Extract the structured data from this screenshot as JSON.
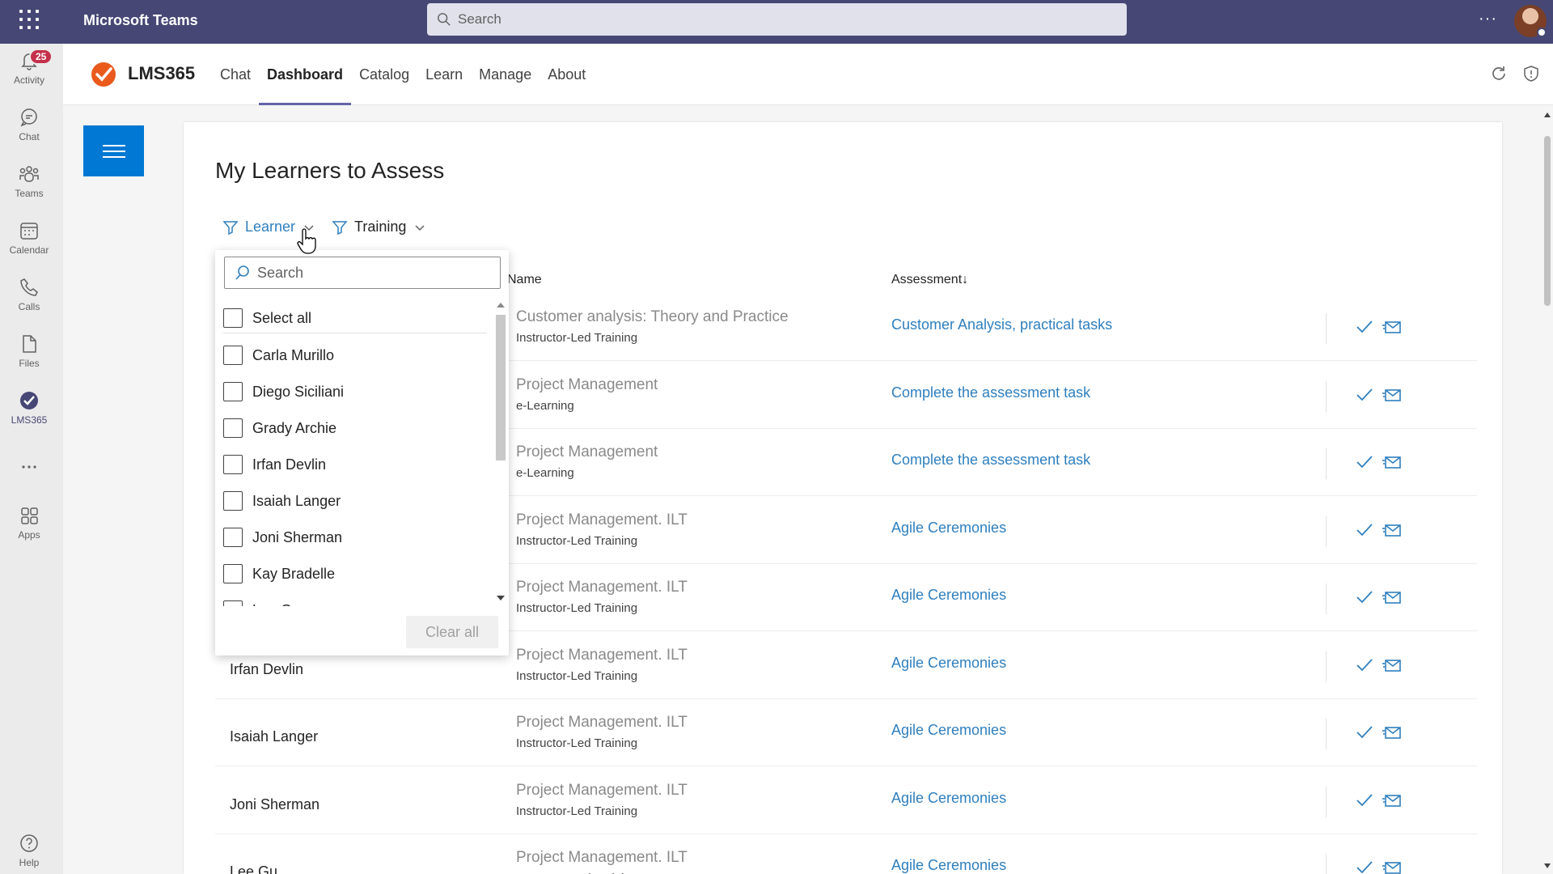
{
  "titlebar": {
    "app_name": "Microsoft Teams",
    "search_placeholder": "Search",
    "more": "···"
  },
  "rail": {
    "items": [
      {
        "label": "Activity",
        "icon": "bell-icon",
        "badge": "25"
      },
      {
        "label": "Chat",
        "icon": "chat-icon"
      },
      {
        "label": "Teams",
        "icon": "teams-icon"
      },
      {
        "label": "Calendar",
        "icon": "calendar-icon"
      },
      {
        "label": "Calls",
        "icon": "phone-icon"
      },
      {
        "label": "Files",
        "icon": "file-icon"
      },
      {
        "label": "LMS365",
        "icon": "lms365-icon"
      },
      {
        "label": "",
        "icon": "more-icon"
      },
      {
        "label": "Apps",
        "icon": "apps-icon"
      },
      {
        "label": "Help",
        "icon": "help-icon"
      }
    ]
  },
  "appbar": {
    "title": "LMS365",
    "tabs": [
      {
        "label": "Chat",
        "active": false
      },
      {
        "label": "Dashboard",
        "active": true
      },
      {
        "label": "Catalog",
        "active": false
      },
      {
        "label": "Learn",
        "active": false
      },
      {
        "label": "Manage",
        "active": false
      },
      {
        "label": "About",
        "active": false
      }
    ]
  },
  "main": {
    "title": "My Learners to Assess",
    "filters": {
      "learner": "Learner",
      "training": "Training"
    },
    "columns": {
      "training_name": "Name",
      "assessment": "Assessment",
      "sort_indicator": "↓"
    },
    "rows": [
      {
        "learner": "",
        "training": "Customer analysis: Theory and Practice",
        "type": "Instructor-Led Training",
        "assessment": "Customer Analysis, practical tasks"
      },
      {
        "learner": "",
        "training": "Project Management",
        "type": "e-Learning",
        "assessment": "Complete the assessment task"
      },
      {
        "learner": "",
        "training": "Project Management",
        "type": "e-Learning",
        "assessment": "Complete the assessment task"
      },
      {
        "learner": "",
        "training": "Project Management. ILT",
        "type": "Instructor-Led Training",
        "assessment": "Agile Ceremonies"
      },
      {
        "learner": "",
        "training": "Project Management. ILT",
        "type": "Instructor-Led Training",
        "assessment": "Agile Ceremonies"
      },
      {
        "learner": "Irfan Devlin",
        "training": "Project Management. ILT",
        "type": "Instructor-Led Training",
        "assessment": "Agile Ceremonies"
      },
      {
        "learner": "Isaiah Langer",
        "training": "Project Management. ILT",
        "type": "Instructor-Led Training",
        "assessment": "Agile Ceremonies"
      },
      {
        "learner": "Joni Sherman",
        "training": "Project Management. ILT",
        "type": "Instructor-Led Training",
        "assessment": "Agile Ceremonies"
      },
      {
        "learner": "Lee Gu",
        "training": "Project Management. ILT",
        "type": "Instructor-Led Training",
        "assessment": "Agile Ceremonies"
      }
    ]
  },
  "dropdown": {
    "search_placeholder": "Search",
    "select_all": "Select all",
    "options": [
      "Carla Murillo",
      "Diego Siciliani",
      "Grady Archie",
      "Irfan Devlin",
      "Isaiah Langer",
      "Joni Sherman",
      "Kay Bradelle",
      "Lee Gu"
    ],
    "clear_label": "Clear all"
  },
  "colors": {
    "titlebar": "#464775",
    "accent": "#6264a7",
    "link": "#2f7fbe",
    "primary_button": "#0078d4",
    "badge": "#c4314b"
  }
}
